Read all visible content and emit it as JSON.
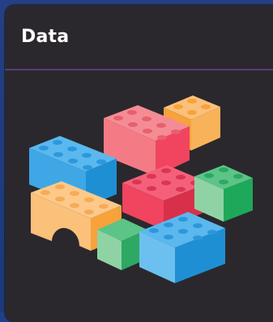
{
  "card": {
    "title": "Data",
    "icon": "lego-bricks-illustration"
  },
  "colors": {
    "page_background": "#1f3f86",
    "card_background": "#2a282d",
    "divider": "#5a3a78",
    "title_text": "#ffffff",
    "brick_blue": "#3fa7e6",
    "brick_red": "#f0445f",
    "brick_pink": "#f58c95",
    "brick_orange": "#f7a23a",
    "brick_peach": "#fbc07a",
    "brick_green": "#39b06a"
  }
}
